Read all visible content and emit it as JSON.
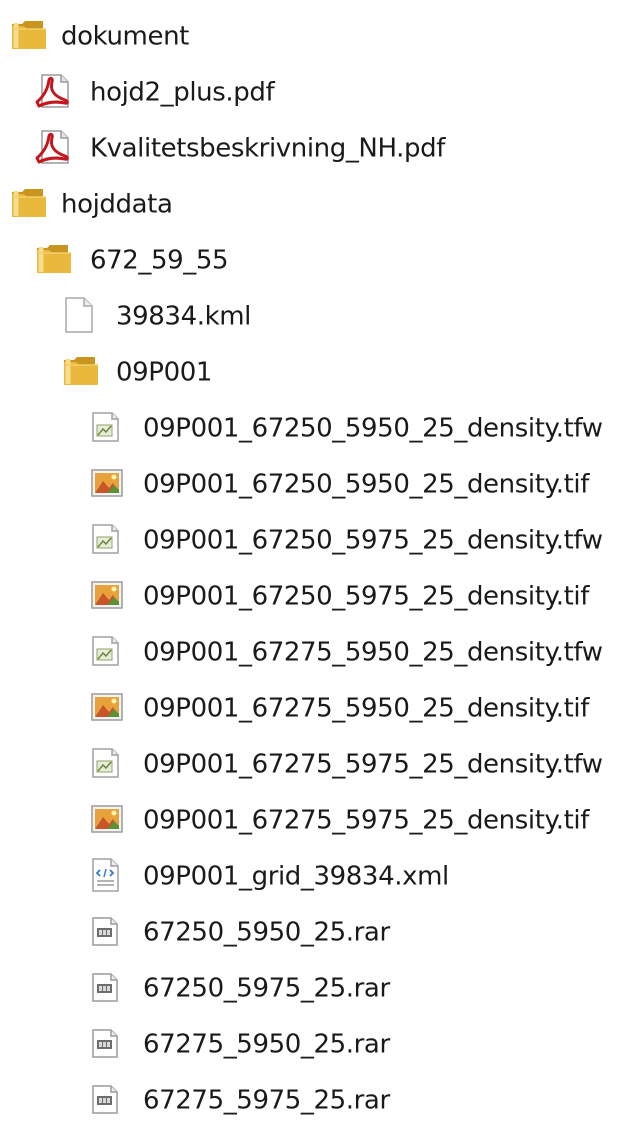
{
  "tree": {
    "items": [
      {
        "label": "dokument",
        "icon": "folder-icon",
        "level": 0
      },
      {
        "label": "hojd2_plus.pdf",
        "icon": "pdf-file-icon",
        "level": 1
      },
      {
        "label": "Kvalitetsbeskrivning_NH.pdf",
        "icon": "pdf-file-icon",
        "level": 1
      },
      {
        "label": "hojddata",
        "icon": "folder-icon",
        "level": 0
      },
      {
        "label": "672_59_55",
        "icon": "folder-icon",
        "level": 1
      },
      {
        "label": "39834.kml",
        "icon": "blank-file-icon",
        "level": 2
      },
      {
        "label": "09P001",
        "icon": "folder-icon",
        "level": 2
      },
      {
        "label": "09P001_67250_5950_25_density.tfw",
        "icon": "tfw-file-icon",
        "level": 3
      },
      {
        "label": "09P001_67250_5950_25_density.tif",
        "icon": "tif-image-icon",
        "level": 3
      },
      {
        "label": "09P001_67250_5975_25_density.tfw",
        "icon": "tfw-file-icon",
        "level": 3
      },
      {
        "label": "09P001_67250_5975_25_density.tif",
        "icon": "tif-image-icon",
        "level": 3
      },
      {
        "label": "09P001_67275_5950_25_density.tfw",
        "icon": "tfw-file-icon",
        "level": 3
      },
      {
        "label": "09P001_67275_5950_25_density.tif",
        "icon": "tif-image-icon",
        "level": 3
      },
      {
        "label": "09P001_67275_5975_25_density.tfw",
        "icon": "tfw-file-icon",
        "level": 3
      },
      {
        "label": "09P001_67275_5975_25_density.tif",
        "icon": "tif-image-icon",
        "level": 3
      },
      {
        "label": "09P001_grid_39834.xml",
        "icon": "xml-file-icon",
        "level": 3
      },
      {
        "label": "67250_5950_25.rar",
        "icon": "rar-archive-icon",
        "level": 3
      },
      {
        "label": "67250_5975_25.rar",
        "icon": "rar-archive-icon",
        "level": 3
      },
      {
        "label": "67275_5950_25.rar",
        "icon": "rar-archive-icon",
        "level": 3
      },
      {
        "label": "67275_5975_25.rar",
        "icon": "rar-archive-icon",
        "level": 3
      }
    ]
  },
  "colors": {
    "folder": "#e8b93c",
    "pdf": "#c4161c",
    "text": "#1a1a1a"
  }
}
